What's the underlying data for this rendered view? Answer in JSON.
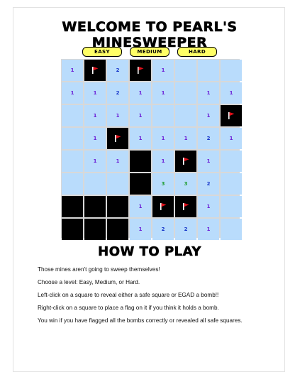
{
  "title": "Welcome to Pearl's Minesweeper",
  "levels": [
    {
      "label": "Easy"
    },
    {
      "label": "Medium"
    },
    {
      "label": "Hard"
    }
  ],
  "colors": {
    "unrevealed": "#b9dcfc",
    "revealed_dark": "#000000",
    "button_bg": "#ffff66",
    "flag": "#e0101a",
    "num_1": "#6a1bd6",
    "num_2": "#1433c9",
    "num_3": "#1a9b2a"
  },
  "board": {
    "rows": 8,
    "cols": 8,
    "cells": [
      [
        "1",
        "F",
        "2",
        "F",
        "1",
        "",
        "",
        ""
      ],
      [
        "1",
        "1",
        "2",
        "1",
        "1",
        "",
        "1",
        "1"
      ],
      [
        "",
        "1",
        "1",
        "1",
        "",
        "",
        "1",
        "F"
      ],
      [
        "",
        "1",
        "F",
        "1",
        "1",
        "1",
        "2",
        "1"
      ],
      [
        "",
        "1",
        "1",
        "D",
        "1",
        "F",
        "1",
        ""
      ],
      [
        "",
        "",
        "",
        "D",
        "3",
        "3",
        "2",
        ""
      ],
      [
        "D",
        "D",
        "D",
        "1",
        "F",
        "F",
        "1",
        ""
      ],
      [
        "D",
        "D",
        "D",
        "1",
        "2",
        "2",
        "1",
        ""
      ]
    ]
  },
  "how_to_play": {
    "heading": "How To Play",
    "lines": [
      "Those mines aren't going to sweep themselves!",
      "Choose a level: Easy, Medium, or Hard.",
      "Left-click on a square to reveal either a safe square or EGAD a bomb!!",
      "Right-click on a square to place a flag on it if you think it holds a bomb.",
      "You win if you have flagged all the bombs correctly or revealed all safe squares."
    ]
  }
}
